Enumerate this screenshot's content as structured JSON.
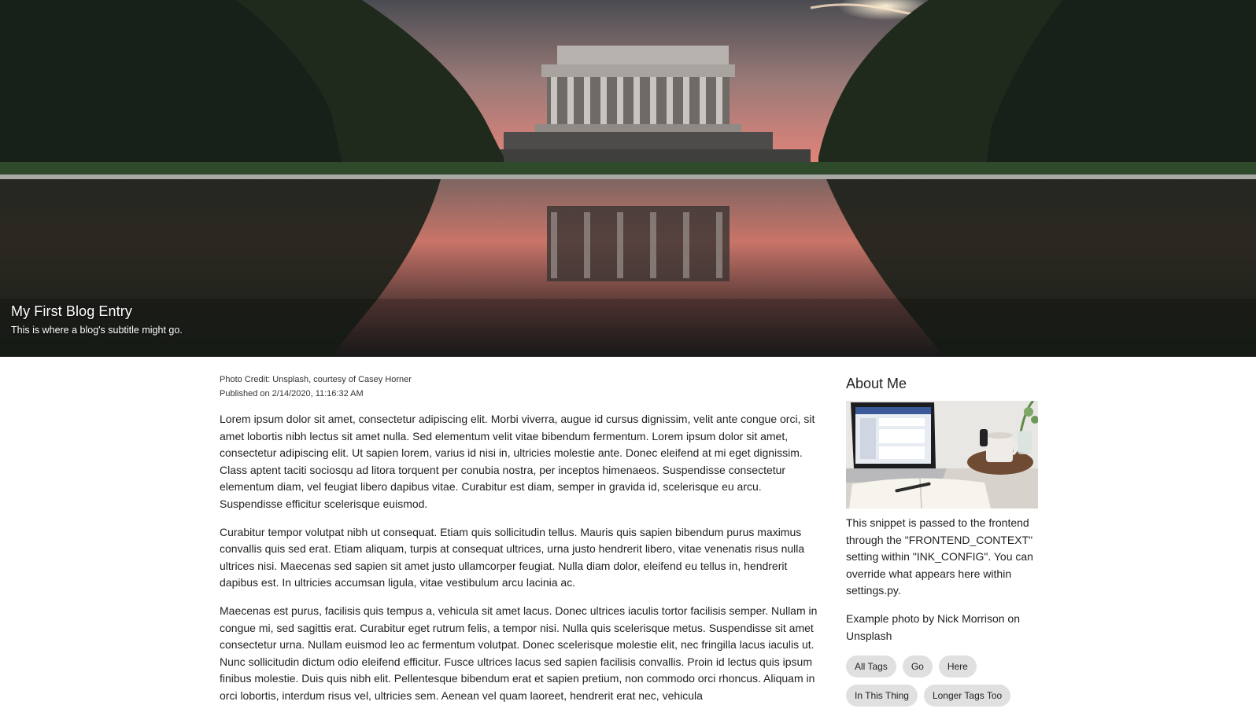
{
  "hero": {
    "title": "My First Blog Entry",
    "subtitle": "This is where a blog's subtitle might go."
  },
  "post": {
    "photo_credit": "Photo Credit: Unsplash, courtesy of Casey Horner",
    "published": "Published on 2/14/2020, 11:16:32 AM",
    "paragraphs": [
      "Lorem ipsum dolor sit amet, consectetur adipiscing elit. Morbi viverra, augue id cursus dignissim, velit ante congue orci, sit amet lobortis nibh lectus sit amet nulla. Sed elementum velit vitae bibendum fermentum. Lorem ipsum dolor sit amet, consectetur adipiscing elit. Ut sapien lorem, varius id nisi in, ultricies molestie ante. Donec eleifend at mi eget dignissim. Class aptent taciti sociosqu ad litora torquent per conubia nostra, per inceptos himenaeos. Suspendisse consectetur elementum diam, vel feugiat libero dapibus vitae. Curabitur est diam, semper in gravida id, scelerisque eu arcu. Suspendisse efficitur scelerisque euismod.",
      "Curabitur tempor volutpat nibh ut consequat. Etiam quis sollicitudin tellus. Mauris quis sapien bibendum purus maximus convallis quis sed erat. Etiam aliquam, turpis at consequat ultrices, urna justo hendrerit libero, vitae venenatis risus nulla ultrices nisi. Maecenas sed sapien sit amet justo ullamcorper feugiat. Nulla diam dolor, eleifend eu tellus in, hendrerit dapibus est. In ultricies accumsan ligula, vitae vestibulum arcu lacinia ac.",
      "Maecenas est purus, facilisis quis tempus a, vehicula sit amet lacus. Donec ultrices iaculis tortor facilisis semper. Nullam in congue mi, sed sagittis erat. Curabitur eget rutrum felis, a tempor nisi. Nulla quis scelerisque metus. Suspendisse sit amet consectetur urna. Nullam euismod leo ac fermentum volutpat. Donec scelerisque molestie elit, nec fringilla lacus iaculis ut. Nunc sollicitudin dictum odio eleifend efficitur. Fusce ultrices lacus sed sapien facilisis convallis. Proin id lectus quis ipsum finibus molestie. Duis quis nibh elit. Pellentesque bibendum erat et sapien pretium, non commodo orci rhoncus. Aliquam in orci lobortis, interdum risus vel, ultricies sem. Aenean vel quam laoreet, hendrerit erat nec, vehicula"
    ]
  },
  "sidebar": {
    "heading": "About Me",
    "description": "This snippet is passed to the frontend through the \"FRONTEND_CONTEXT\" setting within \"INK_CONFIG\". You can override what appears here within settings.py.",
    "photo_note": "Example photo by Nick Morrison on Unsplash",
    "tags": [
      "All Tags",
      "Go",
      "Here",
      "In This Thing",
      "Longer Tags Too"
    ]
  }
}
